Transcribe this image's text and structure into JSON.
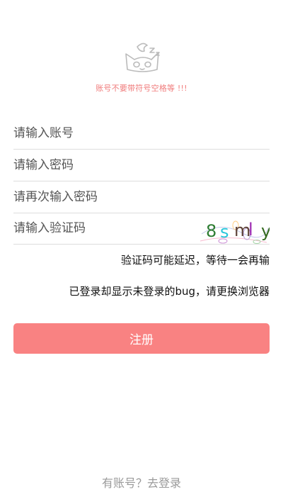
{
  "warning": "账号不要带符号空格等 !!!",
  "fields": {
    "account_placeholder": "请输入账号",
    "password_placeholder": "请输入密码",
    "confirm_placeholder": "请再次输入密码",
    "captcha_placeholder": "请输入验证码"
  },
  "captcha": {
    "chars": [
      "8",
      "s",
      "m",
      "l",
      "y"
    ],
    "colors": [
      "#2e7d32",
      "#26c6da",
      "#5d4037",
      "#9c27b0",
      "#33691e"
    ]
  },
  "notes": {
    "captcha_delay": "验证码可能延迟，等待一会再输",
    "bug_notice": "已登录却显示未登录的bug，请更换浏览器"
  },
  "register_label": "注册",
  "login_link": "有账号？去登录",
  "colors": {
    "accent": "#f98282",
    "warning": "#f07d7d"
  }
}
